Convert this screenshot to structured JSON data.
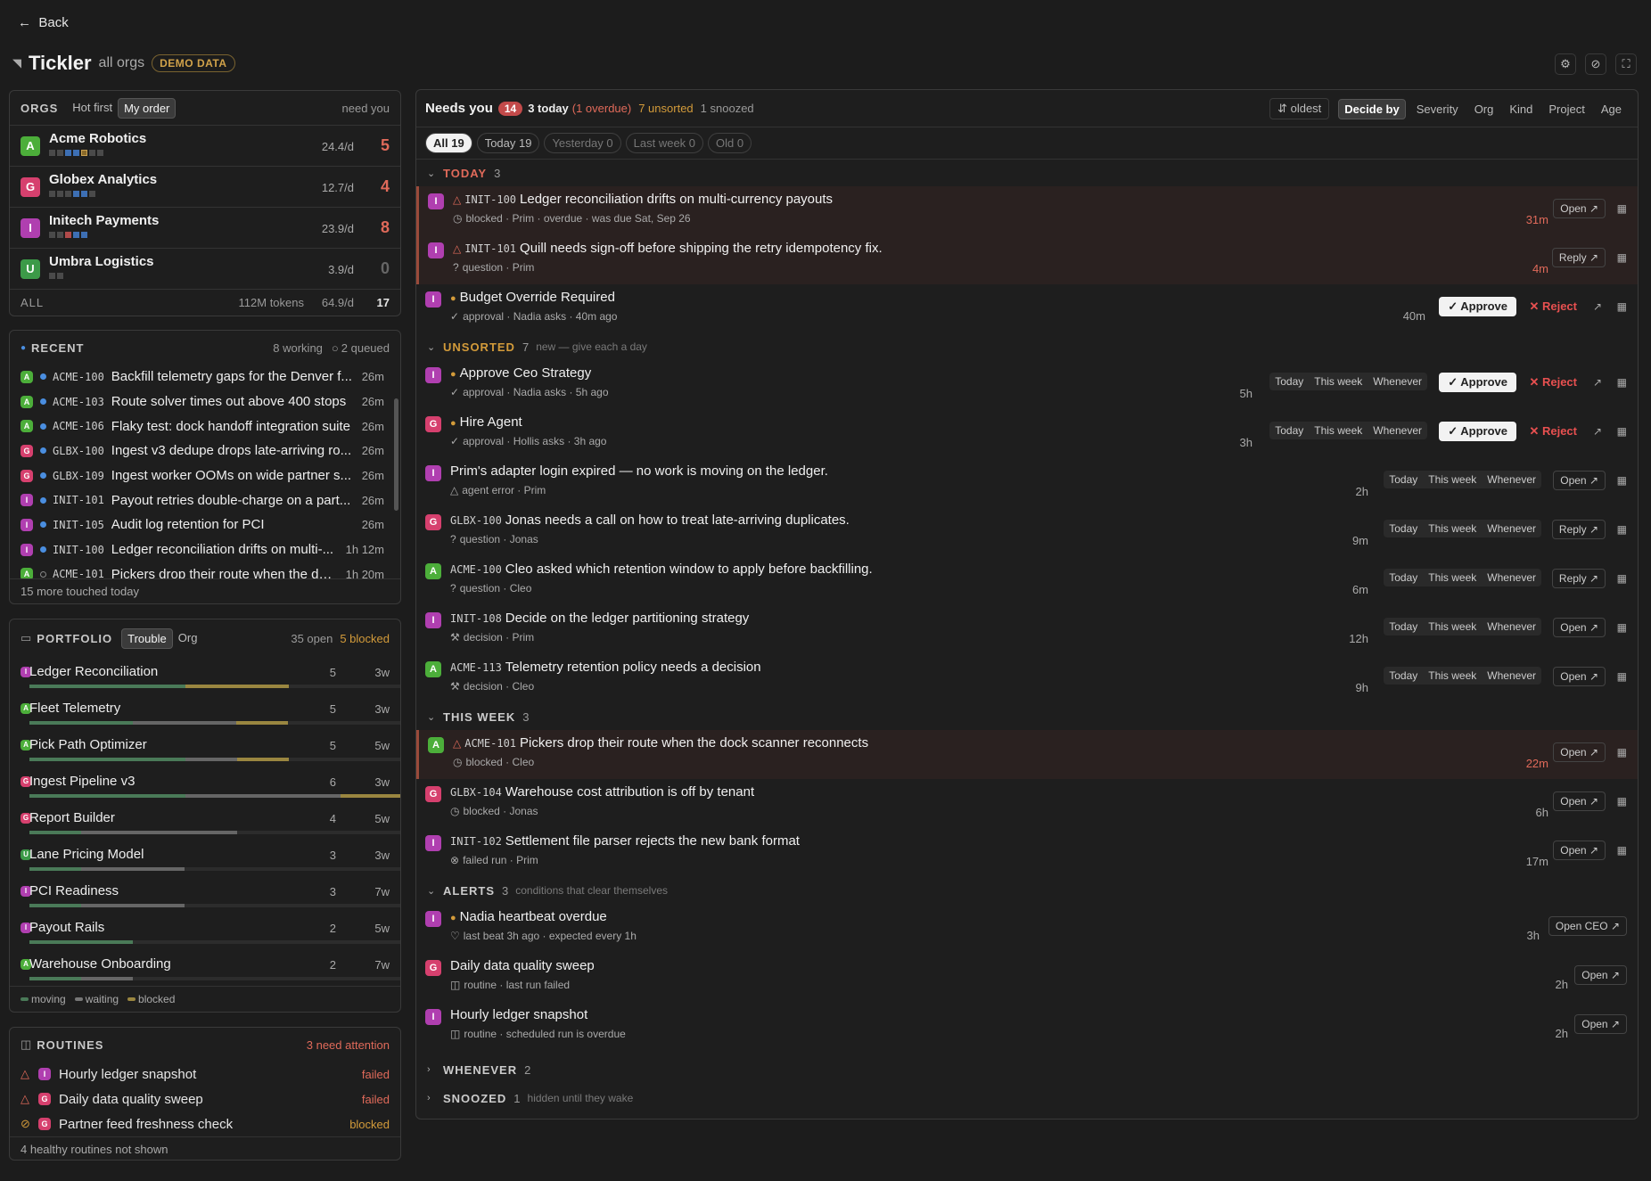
{
  "nav": {
    "back_label": "Back"
  },
  "header": {
    "title": "Tickler",
    "subtitle": "all orgs",
    "badge": "DEMO DATA"
  },
  "orgs": {
    "label": "ORGS",
    "sort_options": [
      "Hot first",
      "My order"
    ],
    "selected_sort": "My order",
    "right_label": "need you",
    "items": [
      {
        "initial": "A",
        "name": "Acme Robotics",
        "rate": "24.4/d",
        "count": "5"
      },
      {
        "initial": "G",
        "name": "Globex Analytics",
        "rate": "12.7/d",
        "count": "4"
      },
      {
        "initial": "I",
        "name": "Initech Payments",
        "rate": "23.9/d",
        "count": "8"
      },
      {
        "initial": "U",
        "name": "Umbra Logistics",
        "rate": "3.9/d",
        "count": "0"
      }
    ],
    "all": {
      "label": "ALL",
      "tokens": "112M tokens",
      "rate": "64.9/d",
      "count": "17"
    }
  },
  "recent": {
    "label": "RECENT",
    "working": "8 working",
    "queued": "2 queued",
    "items": [
      {
        "initial": "A",
        "id": "ACME-100",
        "title": "Backfill telemetry gaps for the Denver f...",
        "age": "26m"
      },
      {
        "initial": "A",
        "id": "ACME-103",
        "title": "Route solver times out above 400 stops",
        "age": "26m"
      },
      {
        "initial": "A",
        "id": "ACME-106",
        "title": "Flaky test: dock handoff integration suite",
        "age": "26m"
      },
      {
        "initial": "G",
        "id": "GLBX-100",
        "title": "Ingest v3 dedupe drops late-arriving ro...",
        "age": "26m"
      },
      {
        "initial": "G",
        "id": "GLBX-109",
        "title": "Ingest worker OOMs on wide partner s...",
        "age": "26m"
      },
      {
        "initial": "I",
        "id": "INIT-101",
        "title": "Payout retries double-charge on a part...",
        "age": "26m"
      },
      {
        "initial": "I",
        "id": "INIT-105",
        "title": "Audit log retention for PCI",
        "age": "26m"
      },
      {
        "initial": "I",
        "id": "INIT-100",
        "title": "Ledger reconciliation drifts on multi-...",
        "age": "1h 12m"
      },
      {
        "initial": "A",
        "id": "ACME-101",
        "title": "Pickers drop their route when the do...",
        "age": "1h 20m"
      }
    ],
    "footer": "15 more touched today"
  },
  "portfolio": {
    "label": "PORTFOLIO",
    "tabs": [
      "Trouble",
      "Org"
    ],
    "selected_tab": "Trouble",
    "open": "35 open",
    "blocked": "5 blocked",
    "items": [
      {
        "initial": "I",
        "name": "Ledger Reconciliation",
        "count": "5",
        "age": "3w",
        "moving": 0.42,
        "waiting": 0,
        "blocked": 0.28
      },
      {
        "initial": "A",
        "name": "Fleet Telemetry",
        "count": "5",
        "age": "3w",
        "moving": 0.28,
        "waiting": 0.28,
        "blocked": 0.14
      },
      {
        "initial": "A",
        "name": "Pick Path Optimizer",
        "count": "5",
        "age": "5w",
        "moving": 0.42,
        "waiting": 0.14,
        "blocked": 0.14
      },
      {
        "initial": "G",
        "name": "Ingest Pipeline v3",
        "count": "6",
        "age": "3w",
        "moving": 0.42,
        "waiting": 0.42,
        "blocked": 0.16
      },
      {
        "initial": "G",
        "name": "Report Builder",
        "count": "4",
        "age": "5w",
        "moving": 0.14,
        "waiting": 0.42,
        "blocked": 0
      },
      {
        "initial": "U",
        "name": "Lane Pricing Model",
        "count": "3",
        "age": "3w",
        "moving": 0.14,
        "waiting": 0.28,
        "blocked": 0
      },
      {
        "initial": "I",
        "name": "PCI Readiness",
        "count": "3",
        "age": "7w",
        "moving": 0.14,
        "waiting": 0.28,
        "blocked": 0
      },
      {
        "initial": "I",
        "name": "Payout Rails",
        "count": "2",
        "age": "5w",
        "moving": 0.28,
        "waiting": 0,
        "blocked": 0
      },
      {
        "initial": "A",
        "name": "Warehouse Onboarding",
        "count": "2",
        "age": "7w",
        "moving": 0.14,
        "waiting": 0.14,
        "blocked": 0
      }
    ],
    "legend": [
      "moving",
      "waiting",
      "blocked"
    ]
  },
  "routines": {
    "label": "ROUTINES",
    "attention": "3 need attention",
    "items": [
      {
        "initial": "I",
        "name": "Hourly ledger snapshot",
        "status": "failed"
      },
      {
        "initial": "G",
        "name": "Daily data quality sweep",
        "status": "failed"
      },
      {
        "initial": "G",
        "name": "Partner feed freshness check",
        "status": "blocked"
      }
    ],
    "footer": "4 healthy routines not shown"
  },
  "main": {
    "title": "Needs you",
    "count": "14",
    "today": "3 today",
    "overdue": "(1 overdue)",
    "unsorted": "7 unsorted",
    "snoozed": "1 snoozed",
    "sort_label": "oldest",
    "group_options": [
      "Decide by",
      "Severity",
      "Org",
      "Kind",
      "Project",
      "Age"
    ],
    "selected_group": "Decide by",
    "day_tabs": [
      "All 19",
      "Today 19",
      "Yesterday 0",
      "Last week 0",
      "Old 0"
    ],
    "sections": {
      "today": {
        "label": "TODAY",
        "count": "3"
      },
      "unsorted": {
        "label": "UNSORTED",
        "count": "7",
        "note": "new — give each a day"
      },
      "thisweek": {
        "label": "THIS WEEK",
        "count": "3"
      },
      "alerts": {
        "label": "ALERTS",
        "count": "3",
        "note": "conditions that clear themselves"
      },
      "whenever": {
        "label": "WHENEVER",
        "count": "2"
      },
      "snoozed": {
        "label": "SNOOZED",
        "count": "1",
        "note": "hidden until they wake"
      }
    },
    "triage": [
      "Today",
      "This week",
      "Whenever"
    ],
    "approve_label": "Approve",
    "reject_label": "Reject",
    "items": [
      {
        "initial": "I",
        "id": "INIT-100",
        "title": "Ledger reconciliation drifts on multi-currency payouts",
        "meta": "blocked · Prim · overdue · was due Sat, Sep 26",
        "age": "31m",
        "action": "Open"
      },
      {
        "initial": "I",
        "id": "INIT-101",
        "title": "Quill needs sign-off before shipping the retry idempotency fix.",
        "meta": "question · Prim",
        "age": "4m",
        "action": "Reply"
      },
      {
        "initial": "I",
        "id": "",
        "title": "Budget Override Required",
        "meta": "approval · Nadia asks · 40m ago",
        "age": "40m",
        "action": ""
      },
      {
        "initial": "I",
        "id": "",
        "title": "Approve Ceo Strategy",
        "meta": "approval · Nadia asks · 5h ago",
        "age": "5h",
        "action": ""
      },
      {
        "initial": "G",
        "id": "",
        "title": "Hire Agent",
        "meta": "approval · Hollis asks · 3h ago",
        "age": "3h",
        "action": ""
      },
      {
        "initial": "I",
        "id": "",
        "title": "Prim's adapter login expired — no work is moving on the ledger.",
        "meta": "agent error · Prim",
        "age": "2h",
        "action": "Open"
      },
      {
        "initial": "G",
        "id": "GLBX-100",
        "title": "Jonas needs a call on how to treat late-arriving duplicates.",
        "meta": "question · Jonas",
        "age": "9m",
        "action": "Reply"
      },
      {
        "initial": "A",
        "id": "ACME-100",
        "title": "Cleo asked which retention window to apply before backfilling.",
        "meta": "question · Cleo",
        "age": "6m",
        "action": "Reply"
      },
      {
        "initial": "I",
        "id": "INIT-108",
        "title": "Decide on the ledger partitioning strategy",
        "meta": "decision · Prim",
        "age": "12h",
        "action": "Open"
      },
      {
        "initial": "A",
        "id": "ACME-113",
        "title": "Telemetry retention policy needs a decision",
        "meta": "decision · Cleo",
        "age": "9h",
        "action": "Open"
      },
      {
        "initial": "A",
        "id": "ACME-101",
        "title": "Pickers drop their route when the dock scanner reconnects",
        "meta": "blocked · Cleo",
        "age": "22m",
        "action": "Open"
      },
      {
        "initial": "G",
        "id": "GLBX-104",
        "title": "Warehouse cost attribution is off by tenant",
        "meta": "blocked · Jonas",
        "age": "6h",
        "action": "Open"
      },
      {
        "initial": "I",
        "id": "INIT-102",
        "title": "Settlement file parser rejects the new bank format",
        "meta": "failed run · Prim",
        "age": "17m",
        "action": "Open"
      },
      {
        "initial": "I",
        "id": "",
        "title": "Nadia heartbeat overdue",
        "meta": "last beat 3h ago · expected every 1h",
        "age": "3h",
        "action": "Open CEO"
      },
      {
        "initial": "G",
        "id": "",
        "title": "Daily data quality sweep",
        "meta": "routine · last run failed",
        "age": "2h",
        "action": "Open"
      },
      {
        "initial": "I",
        "id": "",
        "title": "Hourly ledger snapshot",
        "meta": "routine · scheduled run is overdue",
        "age": "2h",
        "action": "Open"
      }
    ]
  }
}
